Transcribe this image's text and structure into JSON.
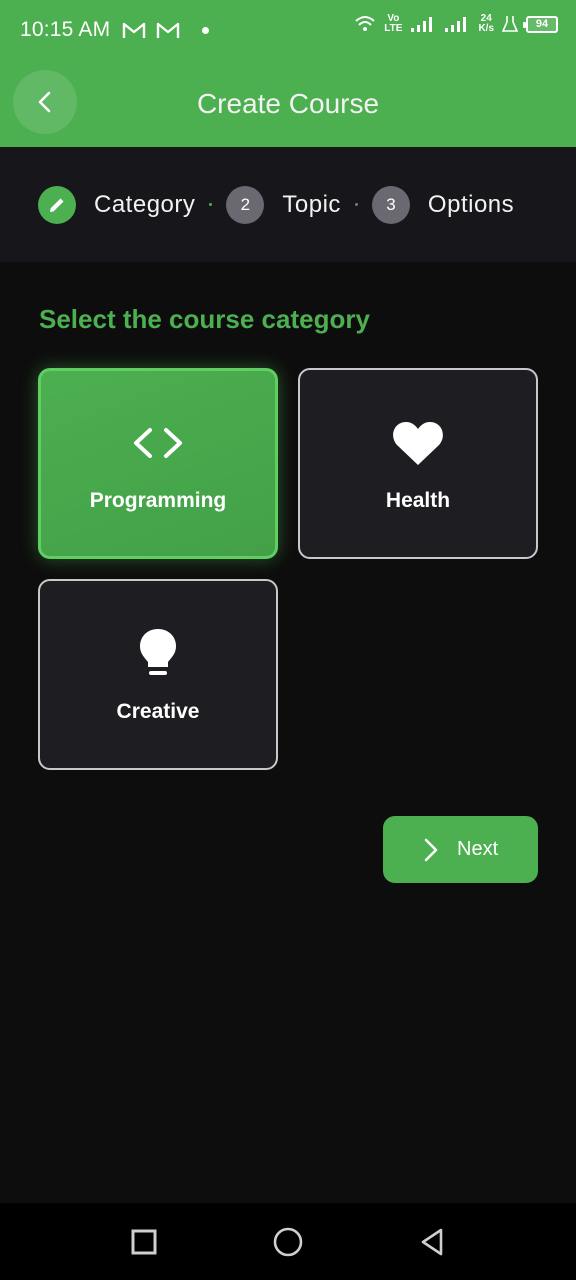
{
  "status_bar": {
    "time": "10:15 AM",
    "network_top": "Vo",
    "network_bottom": "LTE",
    "speed_top": "24",
    "speed_bottom": "K/s",
    "battery": "94",
    "icons": [
      "gmail-icon",
      "gmail-icon",
      "notification-dot-icon",
      "wifi-icon",
      "signal-icon",
      "signal-icon",
      "flask-icon",
      "battery-icon"
    ]
  },
  "app_bar": {
    "title": "Create Course",
    "back_icon": "chevron-left-icon"
  },
  "stepper": {
    "steps": [
      {
        "label": "Category",
        "marker": "",
        "state": "completed",
        "icon": "pencil-icon"
      },
      {
        "label": "Topic",
        "marker": "2",
        "state": "pending"
      },
      {
        "label": "Options",
        "marker": "3",
        "state": "pending"
      }
    ]
  },
  "main": {
    "section_title": "Select the course category",
    "categories": [
      {
        "label": "Programming",
        "icon": "code-icon",
        "selected": true
      },
      {
        "label": "Health",
        "icon": "heart-icon",
        "selected": false
      },
      {
        "label": "Creative",
        "icon": "lightbulb-icon",
        "selected": false
      }
    ],
    "next_button": {
      "label": "Next",
      "icon": "chevron-right-icon"
    }
  },
  "nav_bar": {
    "items": [
      "recents-square-icon",
      "home-circle-icon",
      "back-triangle-icon"
    ]
  },
  "colors": {
    "accent": "#4caf50",
    "background": "#0d0d0d",
    "stepper_bg": "#17161b",
    "card_bg": "#1e1d22",
    "step_idle": "#6a6870"
  }
}
